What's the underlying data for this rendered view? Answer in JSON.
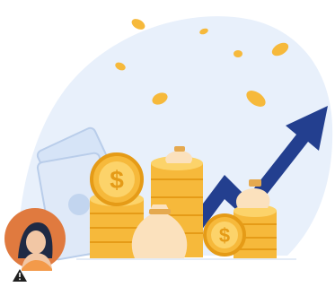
{
  "illustration": {
    "subject": "money-growth",
    "colors": {
      "blob": "#e8f0fb",
      "cash": "#d6e4f7",
      "cash_stroke": "#b9cdea",
      "gold": "#f6b93b",
      "gold_dark": "#e59b17",
      "gold_light": "#fcd36a",
      "sack": "#fbe1bd",
      "sack_tie": "#e5a94f",
      "arrow": "#233f8f",
      "avatar_bg": "#e07a3f",
      "avatar_hair": "#1f2a44",
      "avatar_skin": "#f2c7a5",
      "warning": "#1f1f1f"
    }
  },
  "avatar": {
    "icon": "person-avatar",
    "badge_icon": "warning-icon"
  }
}
